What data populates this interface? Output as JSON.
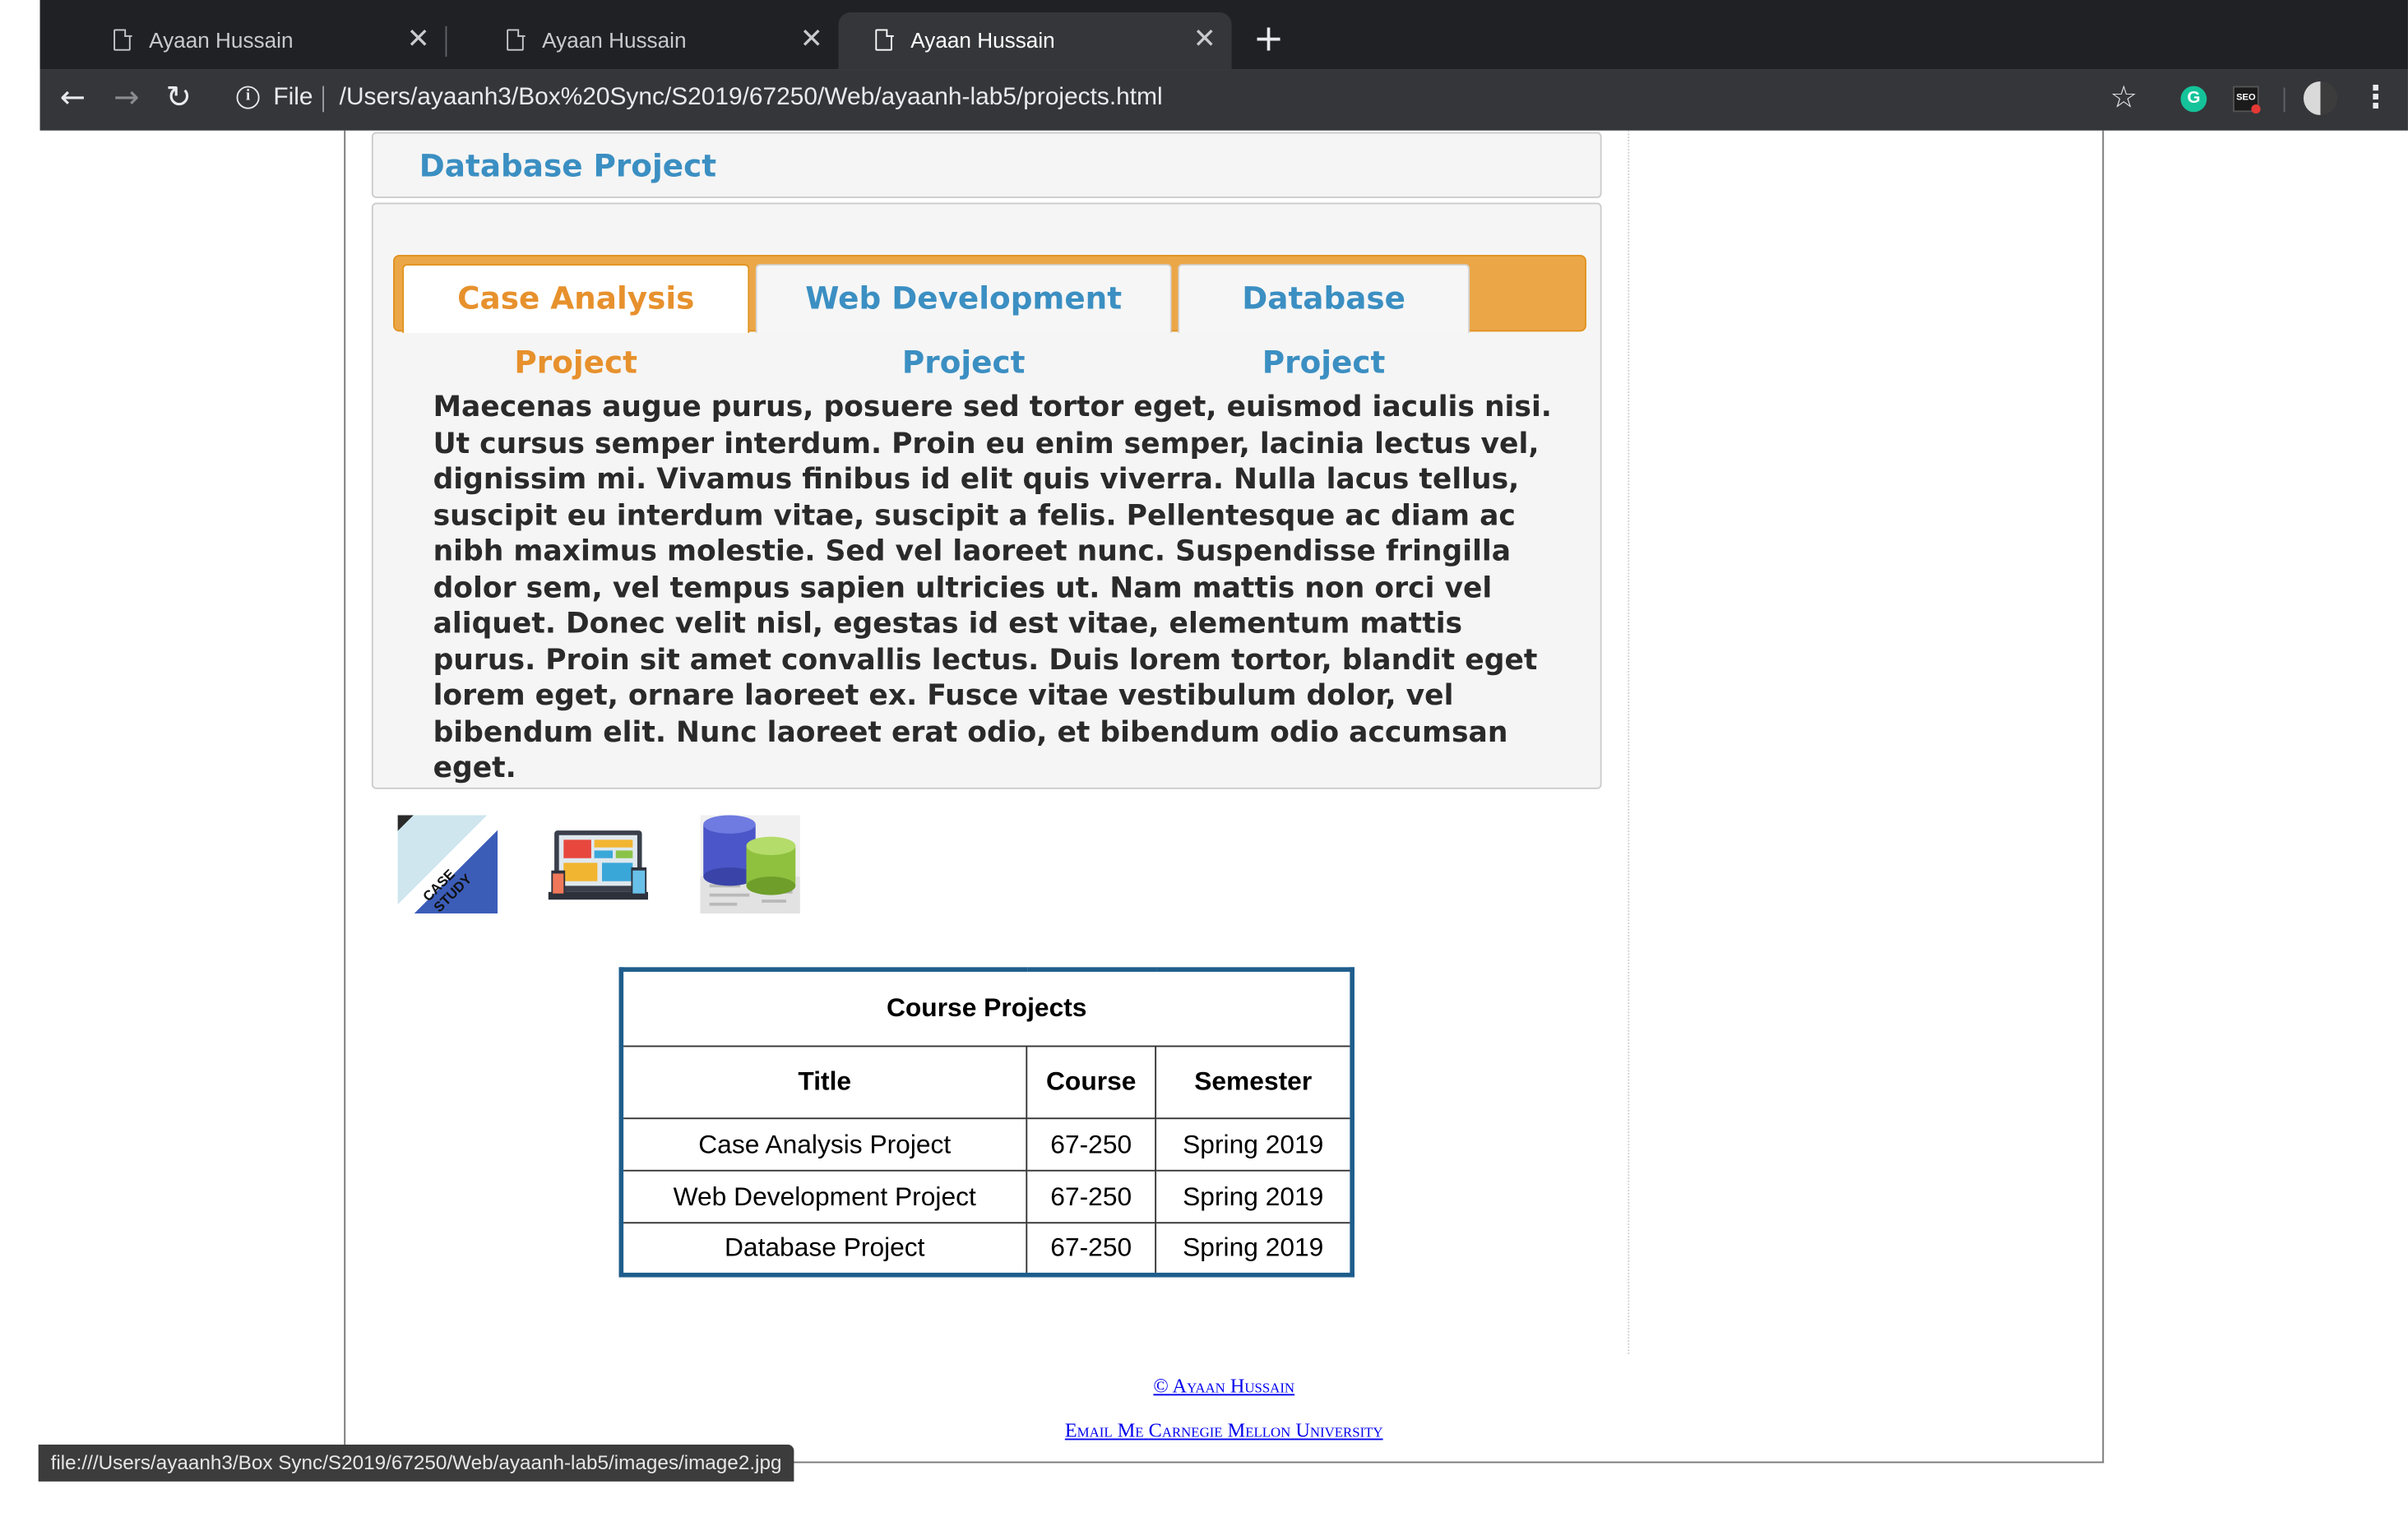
{
  "browser": {
    "tabs": [
      {
        "title": "Ayaan Hussain"
      },
      {
        "title": "Ayaan Hussain"
      },
      {
        "title": "Ayaan Hussain"
      }
    ],
    "active_tab": 2,
    "url_scheme_label": "File",
    "url": "/Users/ayaanh3/Box%20Sync/S2019/67250/Web/ayaanh-lab5/projects.html",
    "status_url": "file:///Users/ayaanh3/Box Sync/S2019/67250/Web/ayaanh-lab5/images/image2.jpg",
    "extension_icons": [
      "grammarly-icon",
      "seo-extension-icon"
    ],
    "colors": {
      "tabbar": "#202124",
      "toolbar": "#35363a"
    }
  },
  "page": {
    "top_header": "Database Project",
    "tabs": [
      {
        "label": "Case Analysis Project",
        "active": true
      },
      {
        "label": "Web Development Project",
        "active": false
      },
      {
        "label": "Database Project",
        "active": false
      }
    ],
    "tab_content": "Maecenas augue purus, posuere sed tortor eget, euismod iaculis nisi. Ut cursus semper interdum. Proin eu enim semper, lacinia lectus vel, dignissim mi. Vivamus finibus id elit quis viverra. Nulla lacus tellus, suscipit eu interdum vitae, suscipit a felis. Pellentesque ac diam ac nibh maximus molestie. Sed vel laoreet nunc. Suspendisse fringilla dolor sem, vel tempus sapien ultricies ut. Nam mattis non orci vel aliquet. Donec velit nisl, egestas id est vitae, elementum mattis purus. Proin sit amet convallis lectus. Duis lorem tortor, blandit eget lorem eget, ornare laoreet ex. Fusce vitae vestibulum dolor, vel bibendum elit. Nunc laoreet erat odio, et bibendum odio accumsan eget.",
    "thumbnails": [
      {
        "name": "case-study-thumbnail",
        "text": "CASE STUDY"
      },
      {
        "name": "web-development-thumbnail"
      },
      {
        "name": "database-thumbnail"
      }
    ],
    "table": {
      "caption": "Course Projects",
      "headers": [
        "Title",
        "Course",
        "Semester"
      ],
      "rows": [
        [
          "Case Analysis Project",
          "67-250",
          "Spring 2019"
        ],
        [
          "Web Development Project",
          "67-250",
          "Spring 2019"
        ],
        [
          "Database Project",
          "67-250",
          "Spring 2019"
        ]
      ]
    },
    "footer": {
      "copyright": "© Ayaan Hussain",
      "email_link": "Email Me",
      "university_link": "Carnegie Mellon University"
    },
    "colors": {
      "accent_orange": "#e7912d",
      "tab_strip": "#eba747",
      "link_blue": "#3b8fc2",
      "table_border": "#1e5d8c"
    }
  }
}
